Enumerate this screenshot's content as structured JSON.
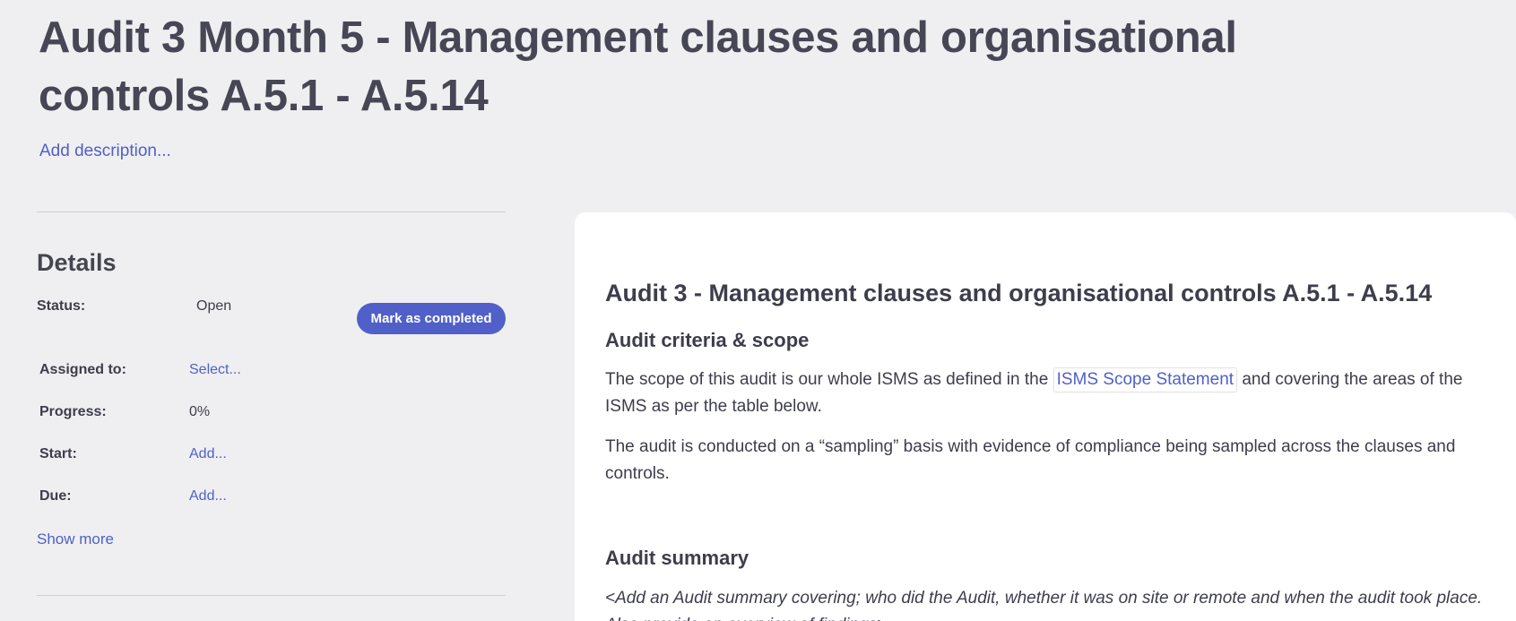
{
  "page": {
    "title": "Audit 3 Month 5 - Management clauses and organisational controls A.5.1 - A.5.14",
    "add_description": "Add description..."
  },
  "details": {
    "heading": "Details",
    "status_label": "Status:",
    "status_value": "Open",
    "mark_completed": "Mark as completed",
    "assigned_label": "Assigned to:",
    "assigned_value": "Select...",
    "progress_label": "Progress:",
    "progress_value": "0%",
    "start_label": "Start:",
    "start_value": "Add...",
    "due_label": "Due:",
    "due_value": "Add...",
    "show_more": "Show more"
  },
  "content": {
    "title": "Audit 3 - Management clauses and organisational controls A.5.1 - A.5.14",
    "criteria_heading": "Audit criteria & scope",
    "scope_text_before": "The scope of this audit is our whole ISMS as defined in the ",
    "scope_link": "ISMS Scope Statement",
    "scope_text_after": " and covering the areas of the ISMS as per the table below.",
    "sampling_text": "The audit is conducted on a “sampling” basis with evidence of compliance being sampled across the clauses and controls.",
    "summary_heading": "Audit summary",
    "summary_placeholder": "<Add an Audit summary covering; who did the Audit, whether it was on site or remote and when the audit took place. Also provide an overview of findings>"
  },
  "colors": {
    "background": "#efeff1",
    "accent": "#5060c8",
    "text": "#3d3d4c",
    "card": "#ffffff"
  }
}
